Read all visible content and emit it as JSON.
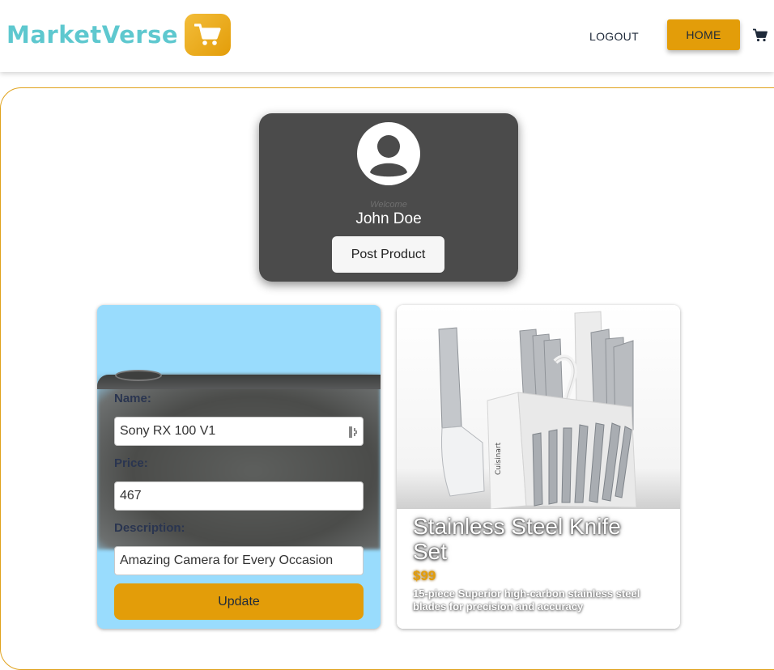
{
  "header": {
    "brand_name": "MarketVerse",
    "logout_label": "LOGOUT",
    "home_label": "HOME",
    "cart_icon": "cart-icon",
    "logo_icon": "cart-icon"
  },
  "profile": {
    "welcome": "Welcome",
    "username": "John Doe",
    "post_button": "Post Product",
    "avatar_icon": "user-circle-icon"
  },
  "edit_product": {
    "name_label": "Name:",
    "name_value": "Sony RX 100 V1",
    "price_label": "Price:",
    "price_value": "467",
    "description_label": "Description:",
    "description_value": "Amazing Camera for Every Occasion",
    "update_button": "Update"
  },
  "product": {
    "title": "Stainless Steel Knife Set",
    "price": "$99",
    "description": "15-piece Superior high-carbon stainless steel blades for precision and accuracy",
    "block_brand": "Cuisinart"
  },
  "colors": {
    "accent": "#e39d09",
    "brand_teal": "#5ec8cf",
    "profile_bg": "#4b4b4b",
    "edit_card_bg": "#99dcfd",
    "text_dark": "#1f2a3a"
  }
}
